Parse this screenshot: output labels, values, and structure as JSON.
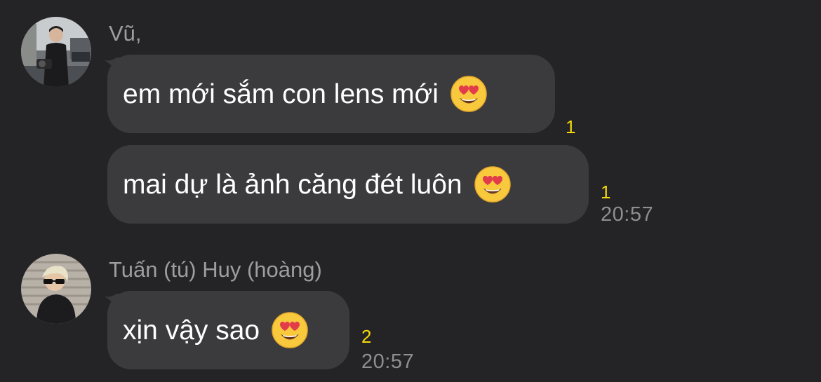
{
  "messages": [
    {
      "sender": "Vũ,",
      "avatar_icon": "user-photo-avatar-vu",
      "bubbles": [
        {
          "text": "em mới sắm con lens mới",
          "emoji": "heart-eyes-emoji",
          "read_count": "1"
        },
        {
          "text": "mai dự là ảnh căng đét luôn",
          "emoji": "heart-eyes-emoji",
          "read_count": "1",
          "time": "20:57"
        }
      ]
    },
    {
      "sender": "Tuấn (tú) Huy (hoàng)",
      "avatar_icon": "user-photo-avatar-tuan",
      "bubbles": [
        {
          "text": "xịn vậy sao",
          "emoji": "heart-eyes-emoji",
          "read_count": "2",
          "time": "20:57"
        }
      ]
    }
  ],
  "colors": {
    "background": "#242426",
    "bubble": "#3b3b3e",
    "sender_name": "#9d9da2",
    "read_count": "#f5d90a",
    "timestamp": "#8e8e93"
  }
}
